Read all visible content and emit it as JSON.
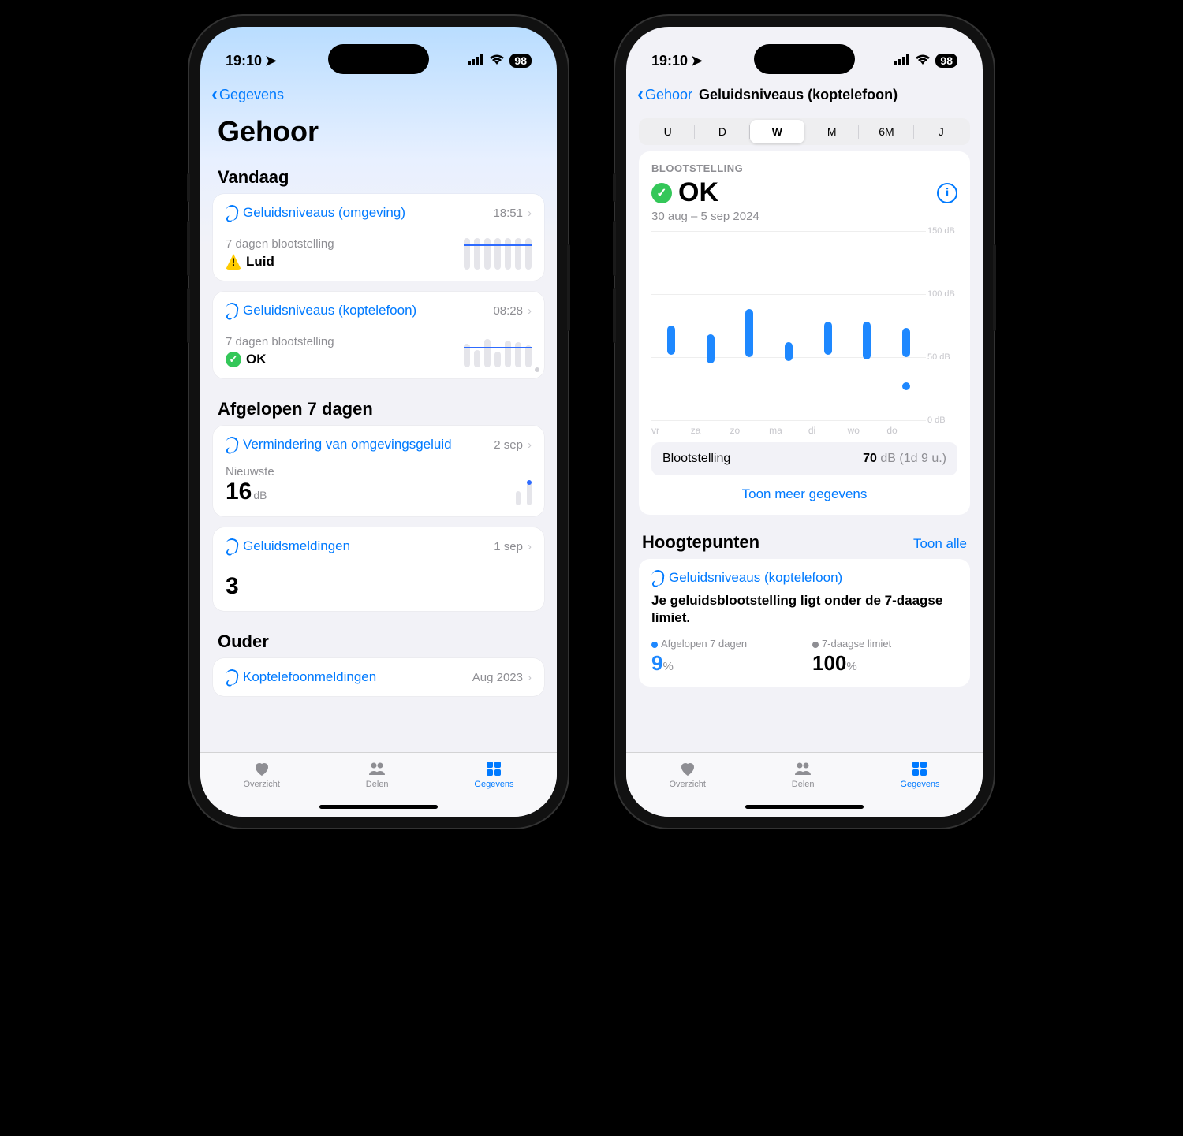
{
  "status": {
    "time": "19:10",
    "battery": "98"
  },
  "left": {
    "back": "Gegevens",
    "title": "Gehoor",
    "sections": {
      "today": "Vandaag",
      "week": "Afgelopen 7 dagen",
      "older": "Ouder"
    },
    "card1": {
      "title": "Geluidsniveaus (omgeving)",
      "time": "18:51",
      "sub": "7 dagen blootstelling",
      "status": "Luid"
    },
    "card2": {
      "title": "Geluidsniveaus (koptelefoon)",
      "time": "08:28",
      "sub": "7 dagen blootstelling",
      "status": "OK"
    },
    "card3": {
      "title": "Vermindering van omgevingsgeluid",
      "time": "2 sep",
      "sub": "Nieuwste",
      "value": "16",
      "unit": "dB"
    },
    "card4": {
      "title": "Geluidsmeldingen",
      "time": "1 sep",
      "value": "3"
    },
    "card5": {
      "title": "Koptelefoonmeldingen",
      "time": "Aug 2023"
    }
  },
  "right": {
    "back": "Gehoor",
    "navtitle": "Geluidsniveaus (koptelefoon)",
    "seg": [
      "U",
      "D",
      "W",
      "M",
      "6M",
      "J"
    ],
    "seg_active": 2,
    "exposure_label": "BLOOTSTELLING",
    "status": "OK",
    "range": "30 aug – 5 sep 2024",
    "inset_label": "Blootstelling",
    "inset_value": "70",
    "inset_unit": "dB (1d 9 u.)",
    "more": "Toon meer gegevens",
    "highlights": "Hoogtepunten",
    "show_all": "Toon alle",
    "hl_title": "Geluidsniveaus (koptelefoon)",
    "hl_text": "Je geluidsblootstelling ligt onder de 7-daagse limiet.",
    "col1_label": "Afgelopen 7 dagen",
    "col1_value": "9",
    "col2_label": "7-daagse limiet",
    "col2_value": "100",
    "pct": "%"
  },
  "tabs": {
    "t1": "Overzicht",
    "t2": "Delen",
    "t3": "Gegevens"
  },
  "chart_data": {
    "type": "range-bar",
    "ylabel": "dB",
    "ylim": [
      0,
      150
    ],
    "yticks": [
      0,
      50,
      100,
      150
    ],
    "categories": [
      "vr",
      "za",
      "zo",
      "ma",
      "di",
      "wo",
      "do"
    ],
    "series": [
      {
        "name": "headphone-level",
        "ranges": [
          [
            52,
            75
          ],
          [
            45,
            68
          ],
          [
            50,
            88
          ],
          [
            47,
            62
          ],
          [
            52,
            78
          ],
          [
            48,
            78
          ],
          [
            50,
            73
          ]
        ]
      }
    ],
    "extra_points": [
      {
        "x": "do",
        "y": 30
      }
    ]
  }
}
